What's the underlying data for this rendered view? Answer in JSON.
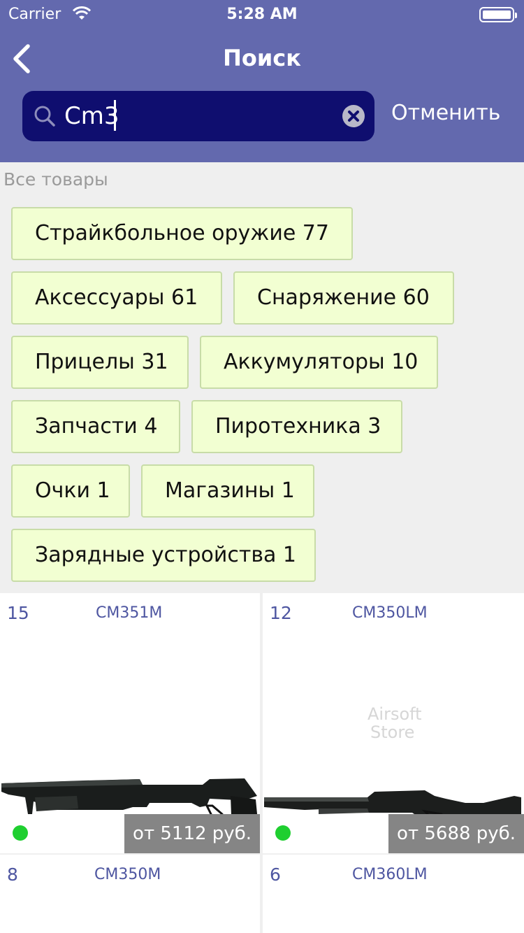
{
  "status_bar": {
    "carrier": "Carrier",
    "time": "5:28 AM"
  },
  "nav": {
    "title": "Поиск"
  },
  "search": {
    "value": "Cm3",
    "cancel_label": "Отменить"
  },
  "categories": {
    "label": "Все товары",
    "items": [
      {
        "label": "Страйкбольное оружие 77"
      },
      {
        "label": "Аксессуары 61"
      },
      {
        "label": "Снаряжение 60"
      },
      {
        "label": "Прицелы 31"
      },
      {
        "label": "Аккумуляторы 10"
      },
      {
        "label": "Запчасти 4"
      },
      {
        "label": "Пиротехника 3"
      },
      {
        "label": "Очки 1"
      },
      {
        "label": "Магазины 1"
      },
      {
        "label": "Зарядные устройства 1"
      }
    ]
  },
  "products": [
    {
      "count": "15",
      "code": "CM351M",
      "price": "от 5112 руб.",
      "in_stock": true,
      "image": "shotgun-pistol-grip-image"
    },
    {
      "count": "12",
      "code": "CM350LM",
      "price": "от 5688 руб.",
      "in_stock": true,
      "image": "shotgun-stock-image",
      "watermark": [
        "Airsoft",
        "Store"
      ]
    },
    {
      "count": "8",
      "code": "CM350M"
    },
    {
      "count": "6",
      "code": "CM360LM"
    }
  ],
  "colors": {
    "header": "#6369ae",
    "search_bg": "#0f0e6f",
    "chip_bg": "#f2ffd2",
    "accent_text": "#4e56a1",
    "in_stock_dot": "#1fcf30"
  }
}
